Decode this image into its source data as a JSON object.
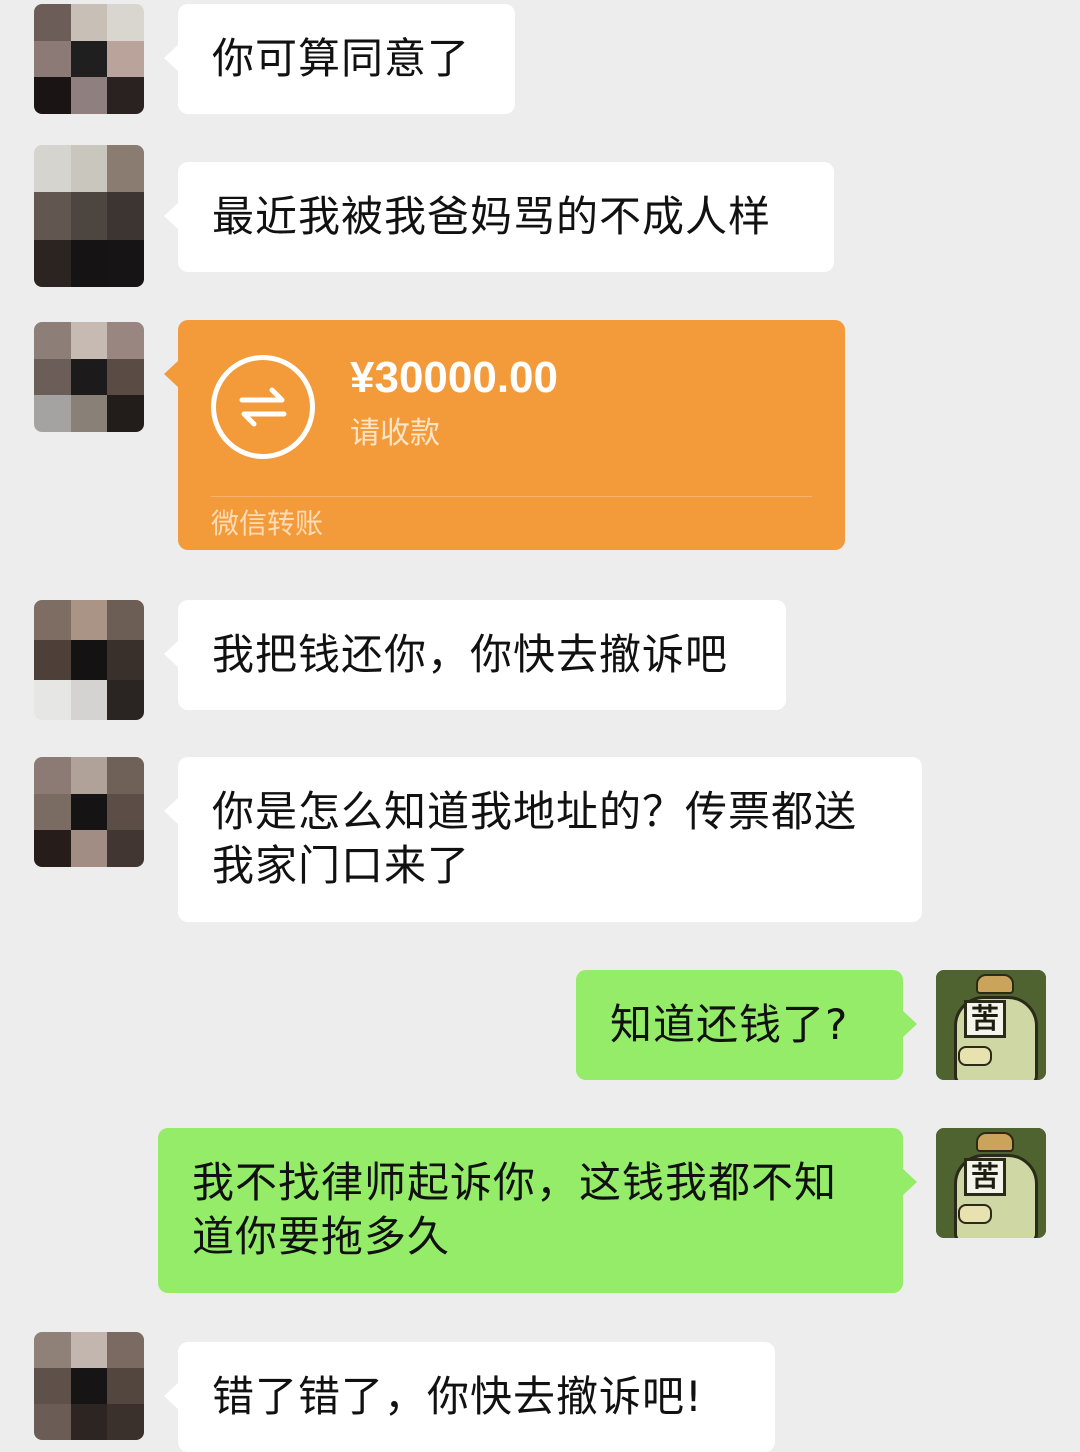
{
  "messages": [
    {
      "side": "in",
      "text": "你可算同意了"
    },
    {
      "side": "in",
      "text": "最近我被我爸妈骂的不成人样"
    },
    {
      "side": "in",
      "type": "transfer",
      "amount": "¥30000.00",
      "status": "请收款",
      "footer": "微信转账"
    },
    {
      "side": "in",
      "text": "我把钱还你，你快去撤诉吧"
    },
    {
      "side": "in",
      "line1": "你是怎么知道我地址的？传票都送",
      "line2": "我家门口来了"
    },
    {
      "side": "out",
      "text": "知道还钱了?"
    },
    {
      "side": "out",
      "line1": "我不找律师起诉你，这钱我都不知",
      "line2": "道你要拖多久"
    },
    {
      "side": "in",
      "text": "错了错了，你快去撤诉吧!"
    }
  ],
  "sticker": {
    "tag": "苦"
  },
  "colors": {
    "background": "#ededed",
    "incoming": "#ffffff",
    "outgoing": "#95ec69",
    "transfer": "#f39b3a"
  },
  "icons": {
    "transfer": "transfer-arrows-icon"
  }
}
